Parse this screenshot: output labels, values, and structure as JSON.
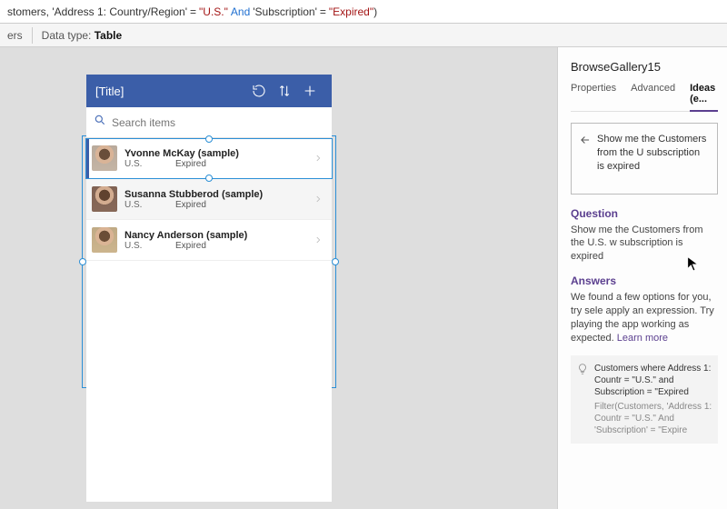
{
  "formula": {
    "prefix": "stomers,",
    "prop1": "'Address 1: Country/Region'",
    "eq1": "=",
    "val1": "\"U.S.\"",
    "kw": "And",
    "prop2": "'Subscription'",
    "eq2": "=",
    "val2": "\"Expired\"",
    "close": ")"
  },
  "meta": {
    "ers_label": "ers",
    "datatype_label": "Data type:",
    "datatype_value": "Table"
  },
  "mobile": {
    "title": "[Title]",
    "search_placeholder": "Search items"
  },
  "rows": [
    {
      "name": "Yvonne McKay (sample)",
      "loc": "U.S.",
      "status": "Expired"
    },
    {
      "name": "Susanna Stubberod (sample)",
      "loc": "U.S.",
      "status": "Expired"
    },
    {
      "name": "Nancy Anderson (sample)",
      "loc": "U.S.",
      "status": "Expired"
    }
  ],
  "panel": {
    "control_name": "BrowseGallery15",
    "tabs": {
      "properties": "Properties",
      "advanced": "Advanced",
      "ideas": "Ideas (e..."
    },
    "query": "Show me the Customers from the U subscription is expired",
    "question_h": "Question",
    "question_p": "Show me the Customers from the U.S. w subscription is expired",
    "answers_h": "Answers",
    "answers_p": "We found a few options for you, try sele apply an expression. Try playing the app working as expected. ",
    "learn_more": "Learn more",
    "answer_title": "Customers where Address 1: Countr = \"U.S.\" and Subscription = \"Expired",
    "answer_formula": "Filter(Customers, 'Address 1: Countr = \"U.S.\" And 'Subscription' = \"Expire"
  }
}
